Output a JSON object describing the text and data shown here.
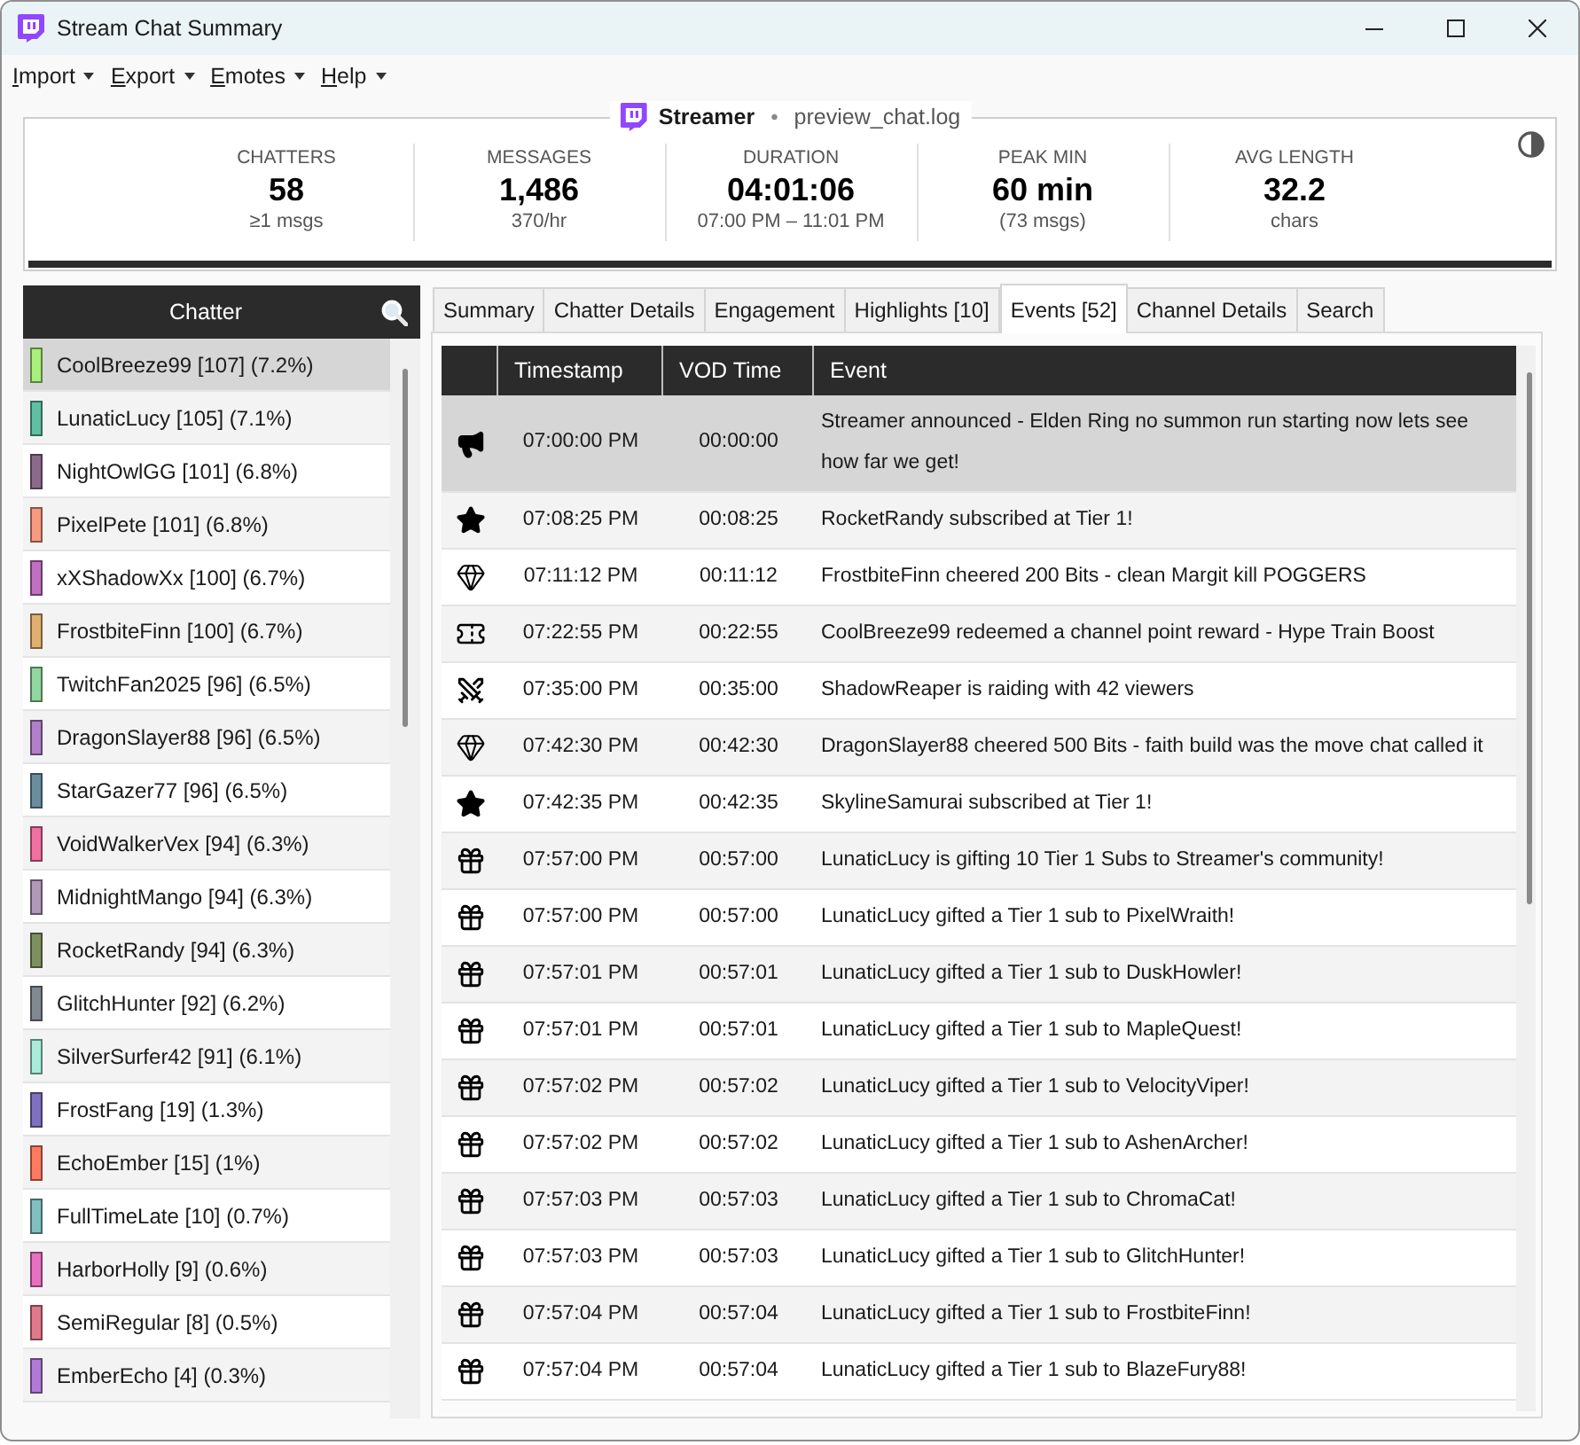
{
  "window": {
    "title": "Stream Chat Summary"
  },
  "menu": [
    "Import",
    "Export",
    "Emotes",
    "Help"
  ],
  "header": {
    "channel": "Streamer",
    "separator": "•",
    "file": "preview_chat.log",
    "stats": [
      {
        "label": "CHATTERS",
        "value": "58",
        "sub": "≥1 msgs"
      },
      {
        "label": "MESSAGES",
        "value": "1,486",
        "sub": "370/hr"
      },
      {
        "label": "DURATION",
        "value": "04:01:06",
        "sub": "07:00 PM – 11:01 PM"
      },
      {
        "label": "PEAK MIN",
        "value": "60 min",
        "sub": "(73 msgs)"
      },
      {
        "label": "AVG LENGTH",
        "value": "32.2",
        "sub": "chars"
      }
    ]
  },
  "chatter_panel": {
    "title": "Chatter",
    "items": [
      {
        "name": "CoolBreeze99 [107] (7.2%)",
        "color": "#a8f07a",
        "selected": true
      },
      {
        "name": "LunaticLucy [105] (7.1%)",
        "color": "#5fbfa3",
        "selected": false
      },
      {
        "name": "NightOwlGG [101] (6.8%)",
        "color": "#8c6a8c",
        "selected": false
      },
      {
        "name": "PixelPete [101] (6.8%)",
        "color": "#f79a80",
        "selected": false
      },
      {
        "name": "xXShadowXx [100] (6.7%)",
        "color": "#c070c0",
        "selected": false
      },
      {
        "name": "FrostbiteFinn [100] (6.7%)",
        "color": "#e0b070",
        "selected": false
      },
      {
        "name": "TwitchFan2025 [96] (6.5%)",
        "color": "#90d8a0",
        "selected": false
      },
      {
        "name": "DragonSlayer88 [96] (6.5%)",
        "color": "#b080c8",
        "selected": false
      },
      {
        "name": "StarGazer77 [96] (6.5%)",
        "color": "#6a8ea0",
        "selected": false
      },
      {
        "name": "VoidWalkerVex [94] (6.3%)",
        "color": "#f070a0",
        "selected": false
      },
      {
        "name": "MidnightMango [94] (6.3%)",
        "color": "#b098b8",
        "selected": false
      },
      {
        "name": "RocketRandy [94] (6.3%)",
        "color": "#7f9060",
        "selected": false
      },
      {
        "name": "GlitchHunter [92] (6.2%)",
        "color": "#808890",
        "selected": false
      },
      {
        "name": "SilverSurfer42 [91] (6.1%)",
        "color": "#a8ecdc",
        "selected": false
      },
      {
        "name": "FrostFang [19] (1.3%)",
        "color": "#8070c0",
        "selected": false
      },
      {
        "name": "EchoEmber [15] (1%)",
        "color": "#ff7a60",
        "selected": false
      },
      {
        "name": "FullTimeLate [10] (0.7%)",
        "color": "#80c0c0",
        "selected": false
      },
      {
        "name": "HarborHolly [9] (0.6%)",
        "color": "#e870c0",
        "selected": false
      },
      {
        "name": "SemiRegular [8] (0.5%)",
        "color": "#e07a8a",
        "selected": false
      },
      {
        "name": "EmberEcho [4] (0.3%)",
        "color": "#b07ad8",
        "selected": false
      }
    ]
  },
  "tabs": [
    {
      "label": "Summary",
      "selected": false
    },
    {
      "label": "Chatter Details",
      "selected": false
    },
    {
      "label": "Engagement",
      "selected": false
    },
    {
      "label": "Highlights [10]",
      "selected": false
    },
    {
      "label": "Events [52]",
      "selected": true
    },
    {
      "label": "Channel Details",
      "selected": false
    },
    {
      "label": "Search",
      "selected": false
    }
  ],
  "events_table": {
    "columns": [
      "Timestamp",
      "VOD Time",
      "Event"
    ],
    "rows": [
      {
        "kind": "announcement",
        "timestamp": "07:00:00 PM",
        "vod_time": "00:00:00",
        "event": "Streamer announced - Elden Ring no summon run starting now lets see how far we get!",
        "selected": true
      },
      {
        "kind": "subscription",
        "timestamp": "07:08:25 PM",
        "vod_time": "00:08:25",
        "event": "RocketRandy subscribed at Tier 1!",
        "selected": false
      },
      {
        "kind": "cheer",
        "timestamp": "07:11:12 PM",
        "vod_time": "00:11:12",
        "event": "FrostbiteFinn cheered 200 Bits - clean Margit kill POGGERS",
        "selected": false
      },
      {
        "kind": "redemption",
        "timestamp": "07:22:55 PM",
        "vod_time": "00:22:55",
        "event": "CoolBreeze99 redeemed a channel point reward - Hype Train Boost",
        "selected": false
      },
      {
        "kind": "raid",
        "timestamp": "07:35:00 PM",
        "vod_time": "00:35:00",
        "event": "ShadowReaper is raiding with 42 viewers",
        "selected": false
      },
      {
        "kind": "cheer",
        "timestamp": "07:42:30 PM",
        "vod_time": "00:42:30",
        "event": "DragonSlayer88 cheered 500 Bits - faith build was the move chat called it",
        "selected": false
      },
      {
        "kind": "subscription",
        "timestamp": "07:42:35 PM",
        "vod_time": "00:42:35",
        "event": "SkylineSamurai subscribed at Tier 1!",
        "selected": false
      },
      {
        "kind": "gift",
        "timestamp": "07:57:00 PM",
        "vod_time": "00:57:00",
        "event": "LunaticLucy is gifting 10 Tier 1 Subs to Streamer's community!",
        "selected": false
      },
      {
        "kind": "gift",
        "timestamp": "07:57:00 PM",
        "vod_time": "00:57:00",
        "event": "LunaticLucy gifted a Tier 1 sub to PixelWraith!",
        "selected": false
      },
      {
        "kind": "gift",
        "timestamp": "07:57:01 PM",
        "vod_time": "00:57:01",
        "event": "LunaticLucy gifted a Tier 1 sub to DuskHowler!",
        "selected": false
      },
      {
        "kind": "gift",
        "timestamp": "07:57:01 PM",
        "vod_time": "00:57:01",
        "event": "LunaticLucy gifted a Tier 1 sub to MapleQuest!",
        "selected": false
      },
      {
        "kind": "gift",
        "timestamp": "07:57:02 PM",
        "vod_time": "00:57:02",
        "event": "LunaticLucy gifted a Tier 1 sub to VelocityViper!",
        "selected": false
      },
      {
        "kind": "gift",
        "timestamp": "07:57:02 PM",
        "vod_time": "00:57:02",
        "event": "LunaticLucy gifted a Tier 1 sub to AshenArcher!",
        "selected": false
      },
      {
        "kind": "gift",
        "timestamp": "07:57:03 PM",
        "vod_time": "00:57:03",
        "event": "LunaticLucy gifted a Tier 1 sub to ChromaCat!",
        "selected": false
      },
      {
        "kind": "gift",
        "timestamp": "07:57:03 PM",
        "vod_time": "00:57:03",
        "event": "LunaticLucy gifted a Tier 1 sub to GlitchHunter!",
        "selected": false
      },
      {
        "kind": "gift",
        "timestamp": "07:57:04 PM",
        "vod_time": "00:57:04",
        "event": "LunaticLucy gifted a Tier 1 sub to FrostbiteFinn!",
        "selected": false
      },
      {
        "kind": "gift",
        "timestamp": "07:57:04 PM",
        "vod_time": "00:57:04",
        "event": "LunaticLucy gifted a Tier 1 sub to BlazeFury88!",
        "selected": false
      }
    ]
  }
}
